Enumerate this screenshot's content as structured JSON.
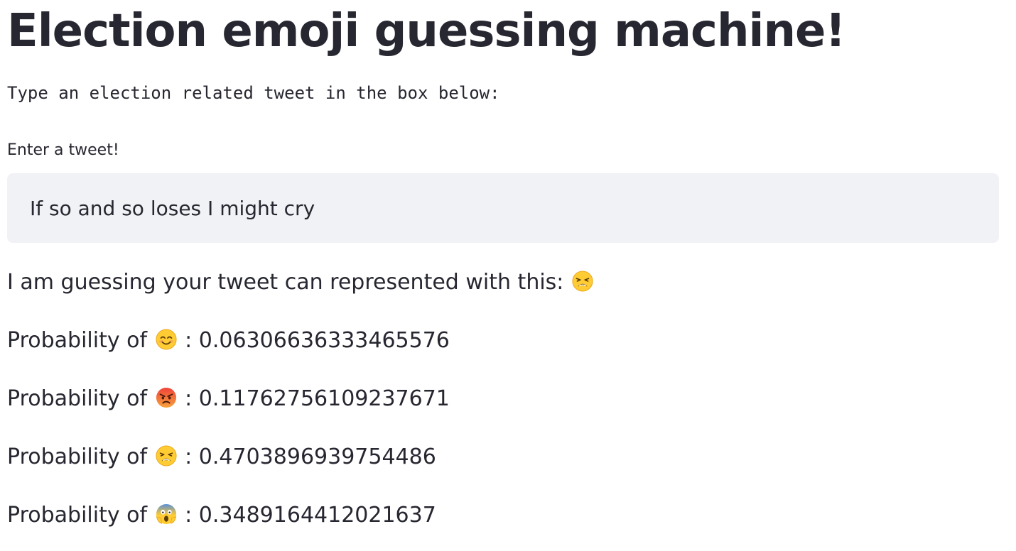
{
  "header": {
    "title": "Election emoji guessing machine!",
    "subtitle": "Type an election related tweet in the box below:"
  },
  "input": {
    "label": "Enter a tweet!",
    "value": "If so and so loses I might cry"
  },
  "result": {
    "guess_text": "I am guessing your tweet can represented with this:",
    "guess_emoji": "weary-face-icon",
    "probabilities": [
      {
        "prefix": "Probability of",
        "emoji": "smiling-face-icon",
        "separator": ":",
        "value": "0.06306636333465576"
      },
      {
        "prefix": "Probability of",
        "emoji": "angry-face-icon",
        "separator": ":",
        "value": "0.11762756109237671"
      },
      {
        "prefix": "Probability of",
        "emoji": "weary-face-icon",
        "separator": ":",
        "value": "0.4703896939754486"
      },
      {
        "prefix": "Probability of",
        "emoji": "screaming-face-icon",
        "separator": ":",
        "value": "0.3489164412021637"
      }
    ]
  },
  "colors": {
    "text": "#262730",
    "input_background": "#f0f2f6",
    "page_background": "#ffffff"
  }
}
